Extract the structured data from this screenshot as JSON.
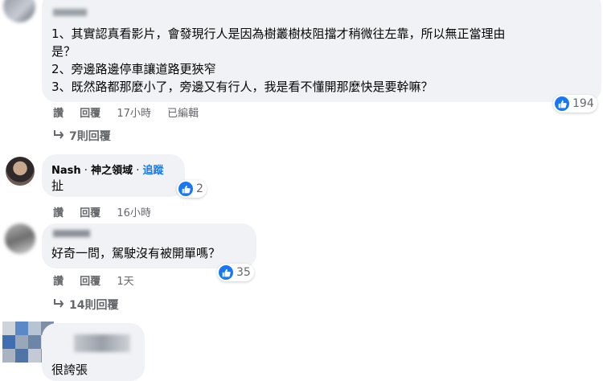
{
  "comments": [
    {
      "lines": [
        "1、其實認真看影片，會發現行人是因為樹叢樹枝阻擋才稍微往左靠，所以無正當理由",
        "是？",
        "2、旁邊路邊停車讓道路更狹窄",
        "3、既然路都那麼小了，旁邊又有行人，我是看不懂開那麼快是要幹嘛？"
      ],
      "like_label": "讚",
      "reply_label": "回覆",
      "time": "17小時",
      "edited": "已編輯",
      "reaction_count": "194",
      "replies_label": "7則回覆"
    },
    {
      "author": "Nash",
      "author_suffix": "神之領域",
      "follow_label": "追蹤",
      "text": "扯",
      "reaction_count": "2",
      "like_label": "讚",
      "reply_label": "回覆",
      "time": "16小時"
    },
    {
      "text": "好奇一問，駕駛沒有被開單嗎？",
      "reaction_count": "35",
      "like_label": "讚",
      "reply_label": "回覆",
      "time": "1天",
      "replies_label": "14則回覆"
    },
    {
      "text": "很誇張"
    }
  ],
  "icons": {
    "like": "thumbs-up-icon",
    "reply_arrow": "reply-arrow-icon"
  },
  "colors": {
    "bubble": "#f0f2f5",
    "like_blue": "#1877f2",
    "muted": "#65676b"
  }
}
